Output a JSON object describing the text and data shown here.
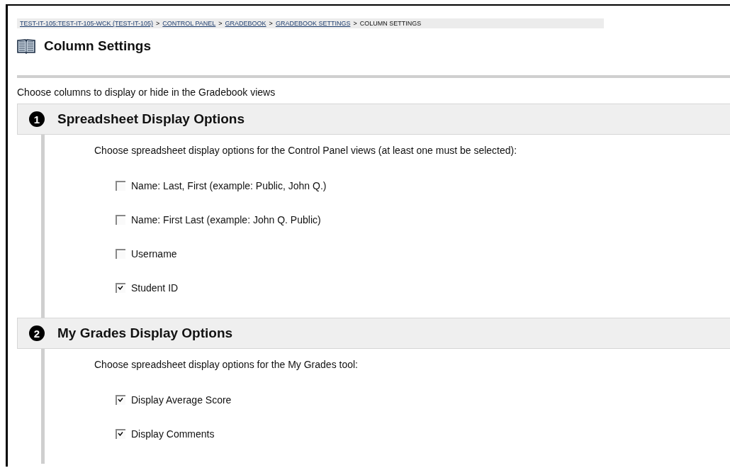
{
  "breadcrumb": {
    "separator": ">",
    "items": [
      {
        "label": "TEST-IT-105:TEST-IT-105-WCK (TEST-IT-105)",
        "link": true
      },
      {
        "label": "CONTROL PANEL",
        "link": true
      },
      {
        "label": "GRADEBOOK",
        "link": true
      },
      {
        "label": "GRADEBOOK SETTINGS",
        "link": true
      },
      {
        "label": "COLUMN SETTINGS",
        "link": false
      }
    ]
  },
  "page_title": "Column Settings",
  "intro": "Choose columns to display or hide in the Gradebook views",
  "sections": [
    {
      "number": "1",
      "title": "Spreadsheet Display Options",
      "description": "Choose spreadsheet display options for the Control Panel views (at least one must be selected):",
      "options": [
        {
          "label": "Name: Last, First (example: Public, John Q.)",
          "checked": false
        },
        {
          "label": "Name: First Last (example: John Q. Public)",
          "checked": false
        },
        {
          "label": "Username",
          "checked": false
        },
        {
          "label": "Student ID",
          "checked": true
        }
      ]
    },
    {
      "number": "2",
      "title": "My Grades Display Options",
      "description": "Choose spreadsheet display options for the My Grades tool:",
      "options": [
        {
          "label": "Display Average Score",
          "checked": true
        },
        {
          "label": "Display Comments",
          "checked": true
        }
      ]
    }
  ]
}
